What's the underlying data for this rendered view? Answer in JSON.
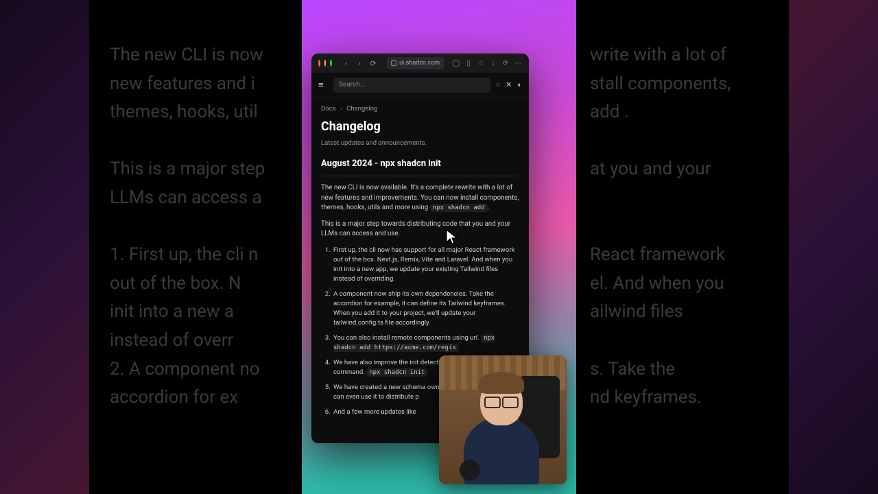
{
  "address_bar": {
    "url": "ui.shadcn.com"
  },
  "site": {
    "search_placeholder": "Search...",
    "breadcrumb": {
      "root": "Docs",
      "current": "Changelog"
    },
    "page": {
      "title": "Changelog",
      "subtitle": "Latest updates and announcements.",
      "heading": "August 2024 - npx shadcn init",
      "p1a": "The new CLI is now available. It's a complete rewrite with a lot of new features and improvements. You can now install components, themes, hooks, utils and more using ",
      "p1_code": "npx shadcn add",
      "p1b": ".",
      "p2": "This is a major step towards distributing code that you and your LLMs can access and use.",
      "list": [
        "First up, the cli now has support for all major React framework out of the box. Next.js, Remix, Vite and Laravel. And when you init into a new app, we update your existing Tailwind files instead of overriding.",
        "A component now ship its own dependencies. Take the accordion for example, it can define its Tailwind keyframes. When you add it to your project, we'll update your tailwind.config.ts file accordingly.",
        "You can also install remote components using url.",
        "We have also improve the init detection and can even init a command.",
        "We have created a new schema own component registry. And can even use it to distribute p",
        "And a few more updates like"
      ],
      "code_li3": "npx shadcn add https://acme.com/regis",
      "code_li4": "npx shadcn init"
    }
  },
  "bg": {
    "left": [
      "The new CLI is now",
      "new features and i",
      "themes, hooks, util",
      "",
      "This is a major step",
      "LLMs can access a",
      "",
      "1. First up, the cli n",
      "   out of the box. N",
      "   init into a new a",
      "   instead of overr",
      "2. A component no",
      "   accordion for ex"
    ],
    "right": [
      "write with a lot of",
      "stall components,",
      "add .",
      "",
      "at you and your",
      "",
      "",
      "React framework",
      "el. And when you",
      "ailwind files",
      "",
      "s. Take the",
      "nd keyframes."
    ]
  }
}
